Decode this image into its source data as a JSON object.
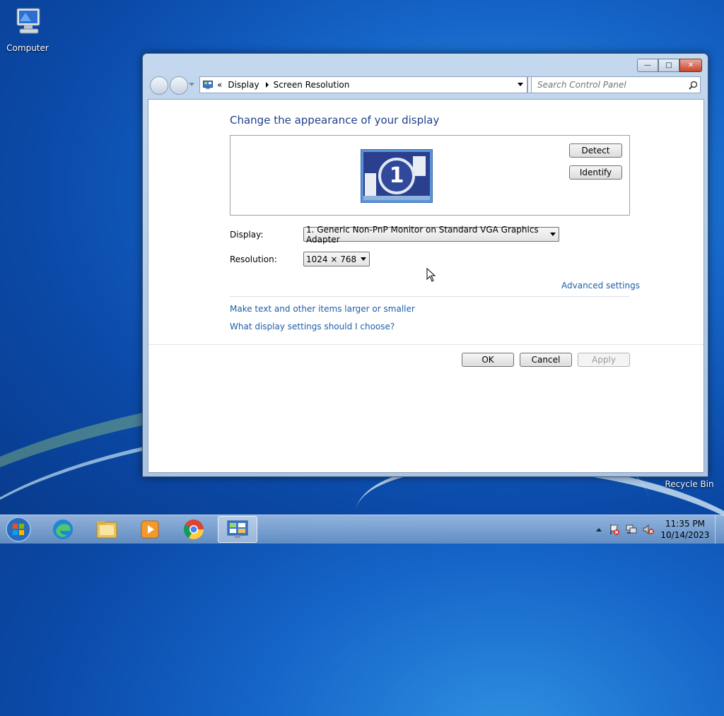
{
  "desktop": {
    "computer_label": "Computer",
    "recycle_label": "Recycle Bin"
  },
  "window": {
    "breadcrumb": {
      "chevrons": "«",
      "display": "Display",
      "screen_resolution": "Screen Resolution"
    },
    "search_placeholder": "Search Control Panel",
    "heading": "Change the appearance of your display",
    "monitor_number": "1",
    "detect_label": "Detect",
    "identify_label": "Identify",
    "display_label": "Display:",
    "display_value": "1. Generic Non-PnP Monitor on Standard VGA Graphics Adapter",
    "resolution_label": "Resolution:",
    "resolution_value": "1024 × 768",
    "advanced_link": "Advanced settings",
    "text_size_link": "Make text and other items larger or smaller",
    "help_link": "What display settings should I choose?",
    "ok_label": "OK",
    "cancel_label": "Cancel",
    "apply_label": "Apply"
  },
  "taskbar": {
    "time": "11:35 PM",
    "date": "10/14/2023",
    "items": [
      "start-orb",
      "edge",
      "file-explorer",
      "media-player",
      "chrome",
      "control-panel"
    ]
  },
  "colors": {
    "heading": "#1e3f8a",
    "link": "#1c5ea8",
    "desktop": "#1565c8"
  }
}
